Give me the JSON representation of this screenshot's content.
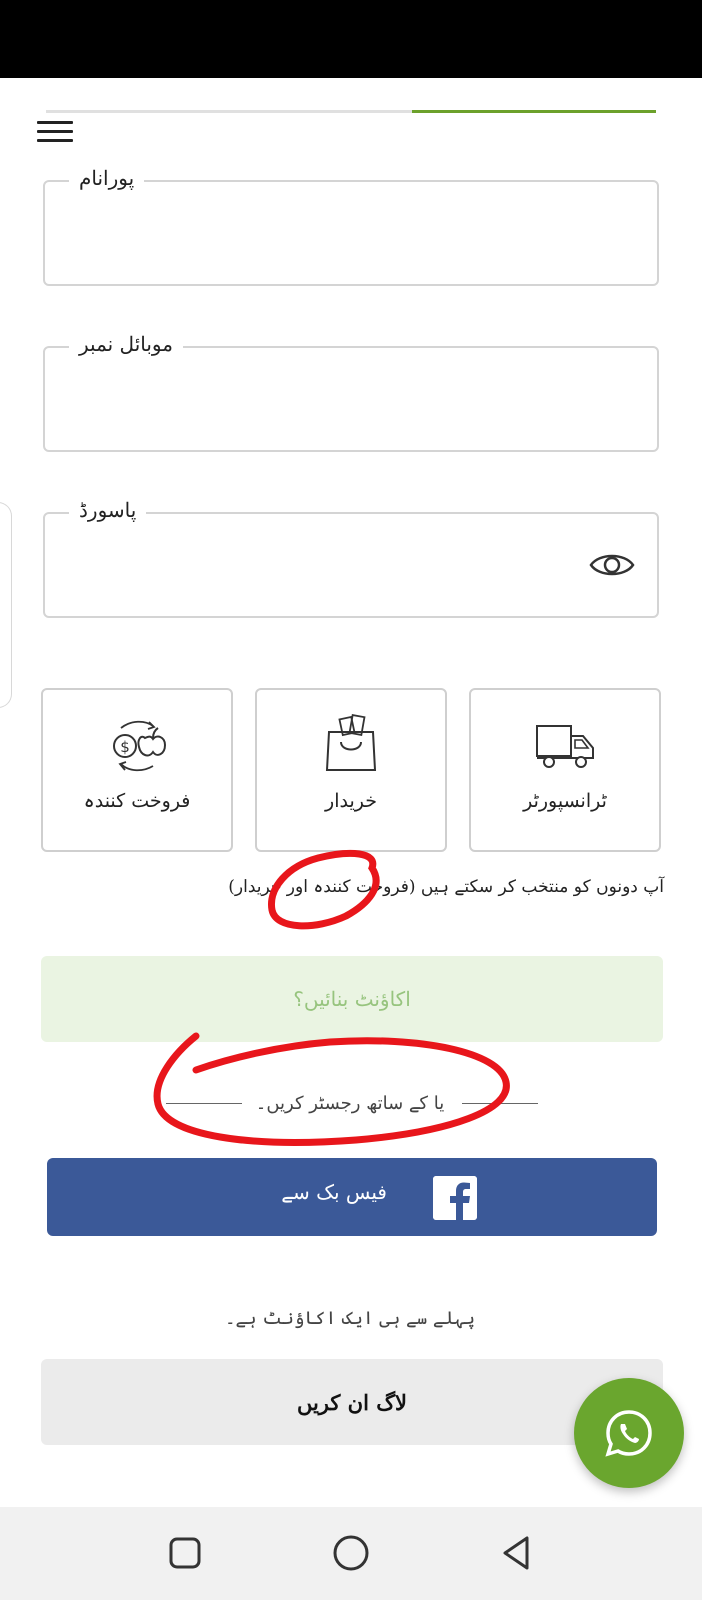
{
  "form": {
    "full_name_label": "پورانام",
    "full_name_value": "",
    "mobile_label": "موبائل نمبر",
    "mobile_value": "",
    "password_label": "پاسورڈ",
    "password_value": ""
  },
  "progress": {
    "fraction": 0.4
  },
  "roles": [
    {
      "label": "فروخت کنندہ",
      "icon": "seller-exchange-icon"
    },
    {
      "label": "خریدار",
      "icon": "shopping-bag-icon"
    },
    {
      "label": "ٹرانسپورٹر",
      "icon": "truck-icon"
    }
  ],
  "note": "آپ دونوں کو منتخب کر سکتے ہیں (فروخت کنندہ اور خریدار)",
  "create_account_label": "اکاؤنٹ بنائیں؟",
  "register_with_label": "یا کے ساتھ رجسٹر کریں۔",
  "facebook_label": "فیس بک سے",
  "already_account_label": "پہلے سے ہی ایک اکاؤنٹ ہے۔",
  "login_label": "لاگ ان کریں",
  "colors": {
    "accent": "#6ca12b",
    "facebook": "#3b5998",
    "whatsapp": "#6aa62e",
    "create_bg": "#eaf4e2",
    "create_text": "#97c47e",
    "annotation": "#e8161b"
  }
}
